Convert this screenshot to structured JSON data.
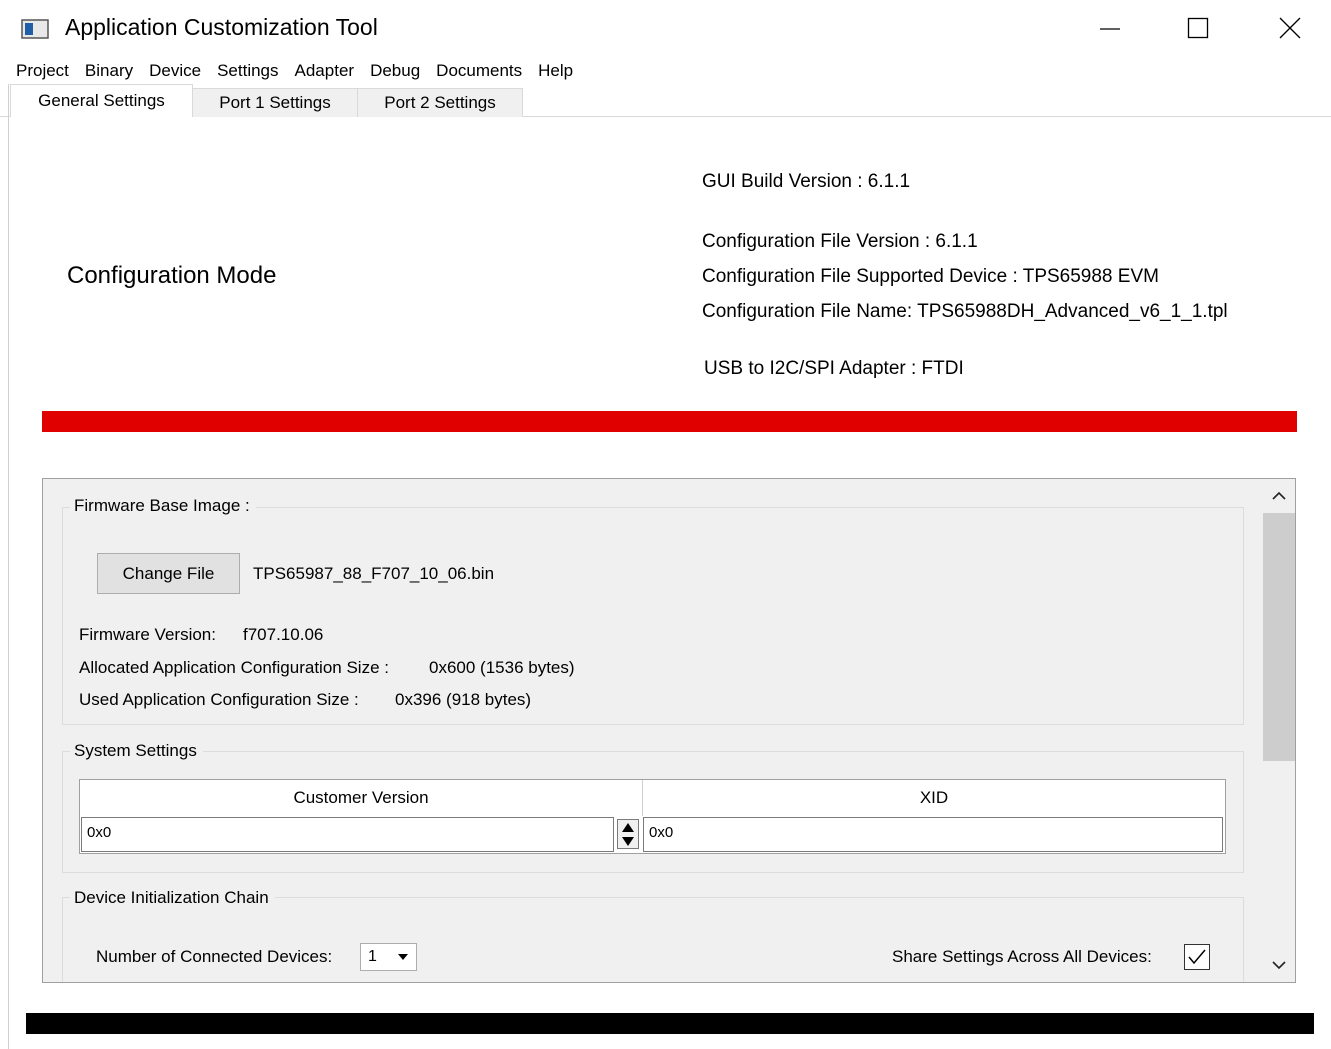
{
  "window": {
    "title": "Application Customization Tool"
  },
  "menu": [
    "Project",
    "Binary",
    "Device",
    "Settings",
    "Adapter",
    "Debug",
    "Documents",
    "Help"
  ],
  "tabs": [
    "General Settings",
    "Port 1 Settings",
    "Port 2 Settings"
  ],
  "active_tab": "General Settings",
  "header": {
    "mode": "Configuration Mode",
    "gui_build_version": "GUI Build Version : 6.1.1",
    "config_file_version": "Configuration File Version : 6.1.1",
    "config_supported_device": "Configuration File Supported Device : TPS65988 EVM",
    "config_file_name": "Configuration File Name: TPS65988DH_Advanced_v6_1_1.tpl",
    "adapter": "USB to I2C/SPI Adapter : FTDI"
  },
  "colors": {
    "status_bar_top": "#e00000",
    "status_bar_bottom": "#000000"
  },
  "firmware": {
    "group_title": "Firmware Base Image :",
    "change_file_label": "Change File",
    "file_name": "TPS65987_88_F707_10_06.bin",
    "version_label": "Firmware Version:",
    "version_value": "f707.10.06",
    "allocated_label": "Allocated Application Configuration Size :",
    "allocated_value": "0x600 (1536 bytes)",
    "used_label": "Used Application Configuration Size :",
    "used_value": "0x396 (918 bytes)"
  },
  "system_settings": {
    "group_title": "System Settings",
    "columns": [
      "Customer Version",
      "XID"
    ],
    "customer_version_value": "0x0",
    "xid_value": "0x0"
  },
  "init_chain": {
    "group_title": "Device Initialization Chain",
    "num_devices_label": "Number of Connected Devices:",
    "num_devices_value": "1",
    "share_label": "Share Settings Across All Devices:",
    "share_checked": true
  }
}
